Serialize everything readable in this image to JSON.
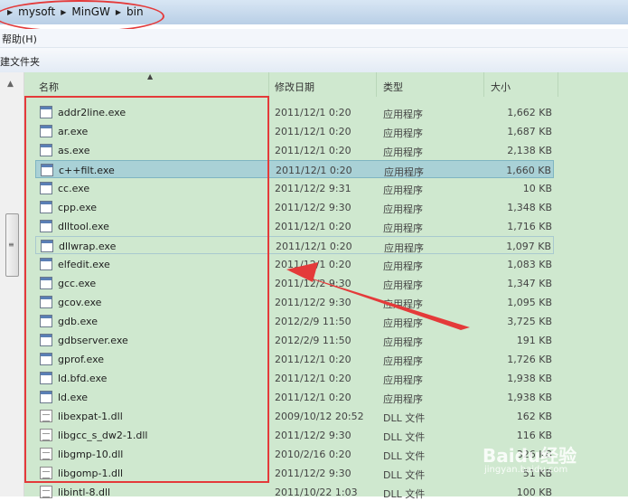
{
  "breadcrumb": [
    "mysoft",
    "MinGW",
    "bin"
  ],
  "menu": {
    "help": "帮助(H)"
  },
  "toolbar": {
    "new_folder": "建文件夹"
  },
  "columns": {
    "name": "名称",
    "date": "修改日期",
    "type": "类型",
    "size": "大小"
  },
  "files": [
    {
      "name": "addr2line.exe",
      "date": "2011/12/1 0:20",
      "type": "应用程序",
      "size": "1,662 KB",
      "kind": "exe"
    },
    {
      "name": "ar.exe",
      "date": "2011/12/1 0:20",
      "type": "应用程序",
      "size": "1,687 KB",
      "kind": "exe"
    },
    {
      "name": "as.exe",
      "date": "2011/12/1 0:20",
      "type": "应用程序",
      "size": "2,138 KB",
      "kind": "exe"
    },
    {
      "name": "c++filt.exe",
      "date": "2011/12/1 0:20",
      "type": "应用程序",
      "size": "1,660 KB",
      "kind": "exe",
      "state": "selected"
    },
    {
      "name": "cc.exe",
      "date": "2011/12/2 9:31",
      "type": "应用程序",
      "size": "10 KB",
      "kind": "exe"
    },
    {
      "name": "cpp.exe",
      "date": "2011/12/2 9:30",
      "type": "应用程序",
      "size": "1,348 KB",
      "kind": "exe"
    },
    {
      "name": "dlltool.exe",
      "date": "2011/12/1 0:20",
      "type": "应用程序",
      "size": "1,716 KB",
      "kind": "exe"
    },
    {
      "name": "dllwrap.exe",
      "date": "2011/12/1 0:20",
      "type": "应用程序",
      "size": "1,097 KB",
      "kind": "exe",
      "state": "hover"
    },
    {
      "name": "elfedit.exe",
      "date": "2011/12/1 0:20",
      "type": "应用程序",
      "size": "1,083 KB",
      "kind": "exe"
    },
    {
      "name": "gcc.exe",
      "date": "2011/12/2 9:30",
      "type": "应用程序",
      "size": "1,347 KB",
      "kind": "exe"
    },
    {
      "name": "gcov.exe",
      "date": "2011/12/2 9:30",
      "type": "应用程序",
      "size": "1,095 KB",
      "kind": "exe"
    },
    {
      "name": "gdb.exe",
      "date": "2012/2/9 11:50",
      "type": "应用程序",
      "size": "3,725 KB",
      "kind": "exe"
    },
    {
      "name": "gdbserver.exe",
      "date": "2012/2/9 11:50",
      "type": "应用程序",
      "size": "191 KB",
      "kind": "exe"
    },
    {
      "name": "gprof.exe",
      "date": "2011/12/1 0:20",
      "type": "应用程序",
      "size": "1,726 KB",
      "kind": "exe"
    },
    {
      "name": "ld.bfd.exe",
      "date": "2011/12/1 0:20",
      "type": "应用程序",
      "size": "1,938 KB",
      "kind": "exe"
    },
    {
      "name": "ld.exe",
      "date": "2011/12/1 0:20",
      "type": "应用程序",
      "size": "1,938 KB",
      "kind": "exe"
    },
    {
      "name": "libexpat-1.dll",
      "date": "2009/10/12 20:52",
      "type": "DLL 文件",
      "size": "162 KB",
      "kind": "dll"
    },
    {
      "name": "libgcc_s_dw2-1.dll",
      "date": "2011/12/2 9:30",
      "type": "DLL 文件",
      "size": "116 KB",
      "kind": "dll"
    },
    {
      "name": "libgmp-10.dll",
      "date": "2010/2/16 0:20",
      "type": "DLL 文件",
      "size": "326 KB",
      "kind": "dll"
    },
    {
      "name": "libgomp-1.dll",
      "date": "2011/12/2 9:30",
      "type": "DLL 文件",
      "size": "51 KB",
      "kind": "dll"
    },
    {
      "name": "libintl-8.dll",
      "date": "2011/10/22 1:03",
      "type": "DLL 文件",
      "size": "100 KB",
      "kind": "dll"
    }
  ],
  "watermark": {
    "text": "Baidu经验",
    "url": "jingyan.baidu.com"
  },
  "colors": {
    "list_bg": "#cfe8cf",
    "annotation": "#e43a3a",
    "selected": "#a9d1d6"
  }
}
